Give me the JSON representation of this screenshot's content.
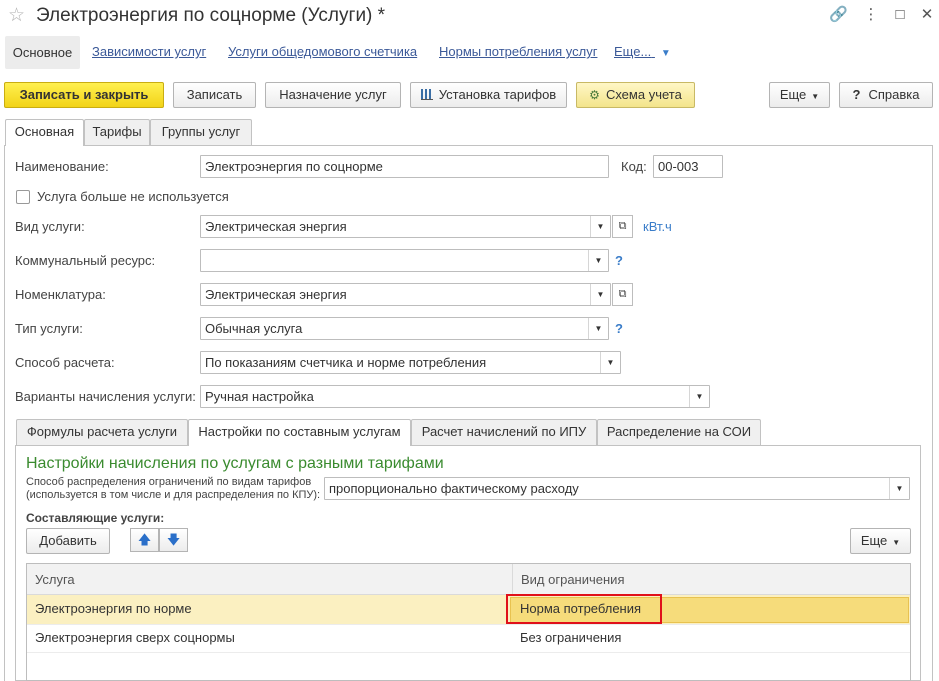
{
  "window": {
    "title": "Электроэнергия по соцнорме (Услуги) *",
    "star_icon": "star-icon",
    "controls": [
      "link-icon",
      "more-icon",
      "minimize-icon",
      "maximize-icon",
      "close-icon"
    ]
  },
  "nav": {
    "active": "Основное",
    "links": [
      "Зависимости услуг",
      "Услуги общедомового счетчика",
      "Нормы потребления услуг",
      "Еще..."
    ]
  },
  "toolbar": {
    "save_close": "Записать и закрыть",
    "save": "Записать",
    "assign": "Назначение услуг",
    "tariffs": "Установка тарифов",
    "scheme": "Схема учета",
    "more": "Еще",
    "help": "Справка",
    "help_icon": "?"
  },
  "tabs": [
    "Основная",
    "Тарифы",
    "Группы услуг"
  ],
  "form": {
    "name_label": "Наименование:",
    "name_value": "Электроэнергия по соцнорме",
    "code_label": "Код:",
    "code_value": "00-003",
    "unused_label": "Услуга больше не используется",
    "type_label": "Вид услуги:",
    "type_value": "Электрическая энергия",
    "unit": "кВт.ч",
    "resource_label": "Коммунальный ресурс:",
    "resource_value": "",
    "nomenclature_label": "Номенклатура:",
    "nomenclature_value": "Электрическая энергия",
    "service_type_label": "Тип услуги:",
    "service_type_value": "Обычная услуга",
    "calc_label": "Способ расчета:",
    "calc_value": "По показаниям счетчика и норме потребления",
    "variant_label": "Варианты начисления услуги:",
    "variant_value": "Ручная настройка",
    "hint": "?"
  },
  "inner_tabs": [
    "Формулы расчета услуги",
    "Настройки по составным услугам",
    "Расчет начислений по ИПУ",
    "Распределение на СОИ"
  ],
  "panel": {
    "title": "Настройки начисления по услугам с разными тарифами",
    "dist_label_1": "Способ распределения ограничений по видам тарифов",
    "dist_label_2": "(используется в том числе и для распределения по КПУ):",
    "dist_value": "пропорционально фактическому расходу",
    "components_label": "Составляющие услуги:",
    "add_button": "Добавить",
    "up_icon": "🡅",
    "down_icon": "🡇",
    "more_button": "Еще"
  },
  "table": {
    "headers": [
      "Услуга",
      "Вид ограничения"
    ],
    "rows": [
      {
        "service": "Электроэнергия по норме",
        "limit": "Норма потребления"
      },
      {
        "service": "Электроэнергия сверх соцнормы",
        "limit": "Без ограничения"
      }
    ]
  }
}
